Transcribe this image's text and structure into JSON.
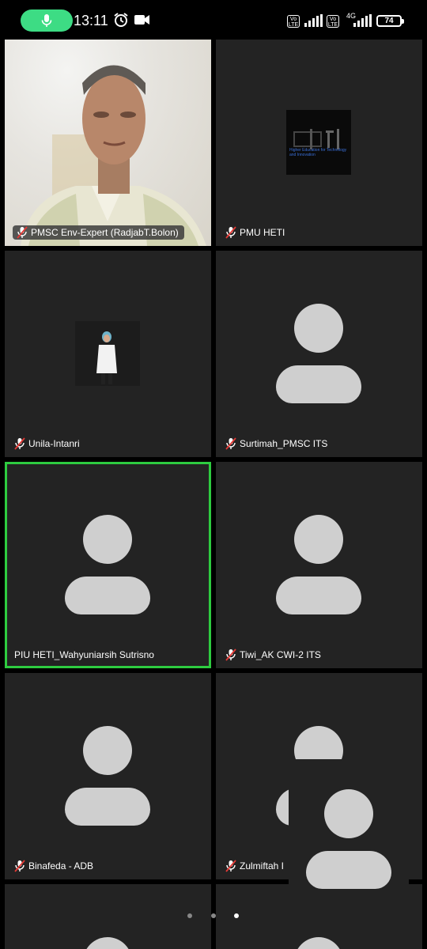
{
  "status_bar": {
    "time": "13:11",
    "battery": "74",
    "network": "4G",
    "volte_label": "Vo LTE",
    "icons": [
      "mic-icon",
      "alarm-icon",
      "video-camera-icon",
      "volte-icon",
      "signal-icon",
      "battery-icon"
    ]
  },
  "participants": [
    {
      "name": "PMSC Env-Expert (RadjabT.Bolon)",
      "muted": true,
      "type": "video"
    },
    {
      "name": "PMU HETI",
      "muted": true,
      "type": "logo",
      "logo_text": "Higher Education for Technology and Innovation"
    },
    {
      "name": "Unila-Intanri",
      "muted": true,
      "type": "photo"
    },
    {
      "name": "Surtimah_PMSC ITS",
      "muted": true,
      "type": "avatar"
    },
    {
      "name": "PIU HETI_Wahyuniarsih Sutrisno",
      "muted": false,
      "type": "avatar",
      "active_speaker": true
    },
    {
      "name": "Tiwi_AK CWI-2 ITS",
      "muted": true,
      "type": "avatar"
    },
    {
      "name": "Binafeda - ADB",
      "muted": true,
      "type": "avatar"
    },
    {
      "name": "Zulmiftah I",
      "muted": true,
      "type": "avatar"
    },
    {
      "name": "",
      "muted": false,
      "type": "avatar"
    },
    {
      "name": "",
      "muted": false,
      "type": "avatar"
    }
  ],
  "pager": {
    "pages": 3,
    "current": 3
  },
  "colors": {
    "active_border": "#2ecc40",
    "mic_pill": "#3ddc84",
    "tile_bg": "#232323",
    "avatar": "#cfcfcf",
    "muted_mic": "#e53935"
  }
}
